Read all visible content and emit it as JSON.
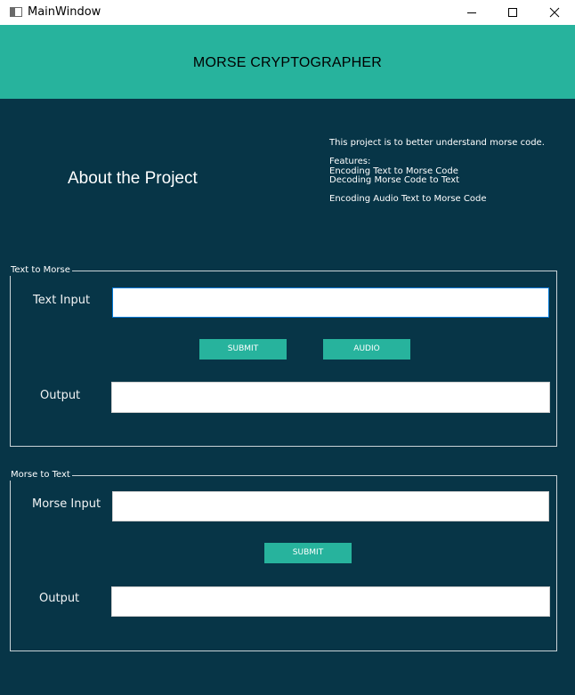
{
  "window": {
    "title": "MainWindow",
    "app_icon": "window-app-icon",
    "controls": [
      "minimize-icon",
      "maximize-icon",
      "close-icon"
    ]
  },
  "header": {
    "title": "MORSE CRYPTOGRAPHER",
    "color": "#27b39d"
  },
  "about": {
    "title": "About the Project",
    "description": "This project is to better understand morse code.\n\nFeatures:\nEncoding Text to Morse Code\nDecoding Morse Code to Text\n\nEncoding Audio Text to Morse Code"
  },
  "text_to_morse": {
    "group_title": "Text to Morse",
    "input_label": "Text Input",
    "input_value": "",
    "submit_label": "SUBMIT",
    "audio_label": "AUDIO",
    "output_label": "Output",
    "output_value": ""
  },
  "morse_to_text": {
    "group_title": "Morse to Text",
    "input_label": "Morse Input",
    "input_value": "",
    "submit_label": "SUBMIT",
    "output_label": "Output",
    "output_value": ""
  },
  "colors": {
    "accent": "#27b39d",
    "background": "#073547",
    "focus_border": "#0078d7"
  }
}
